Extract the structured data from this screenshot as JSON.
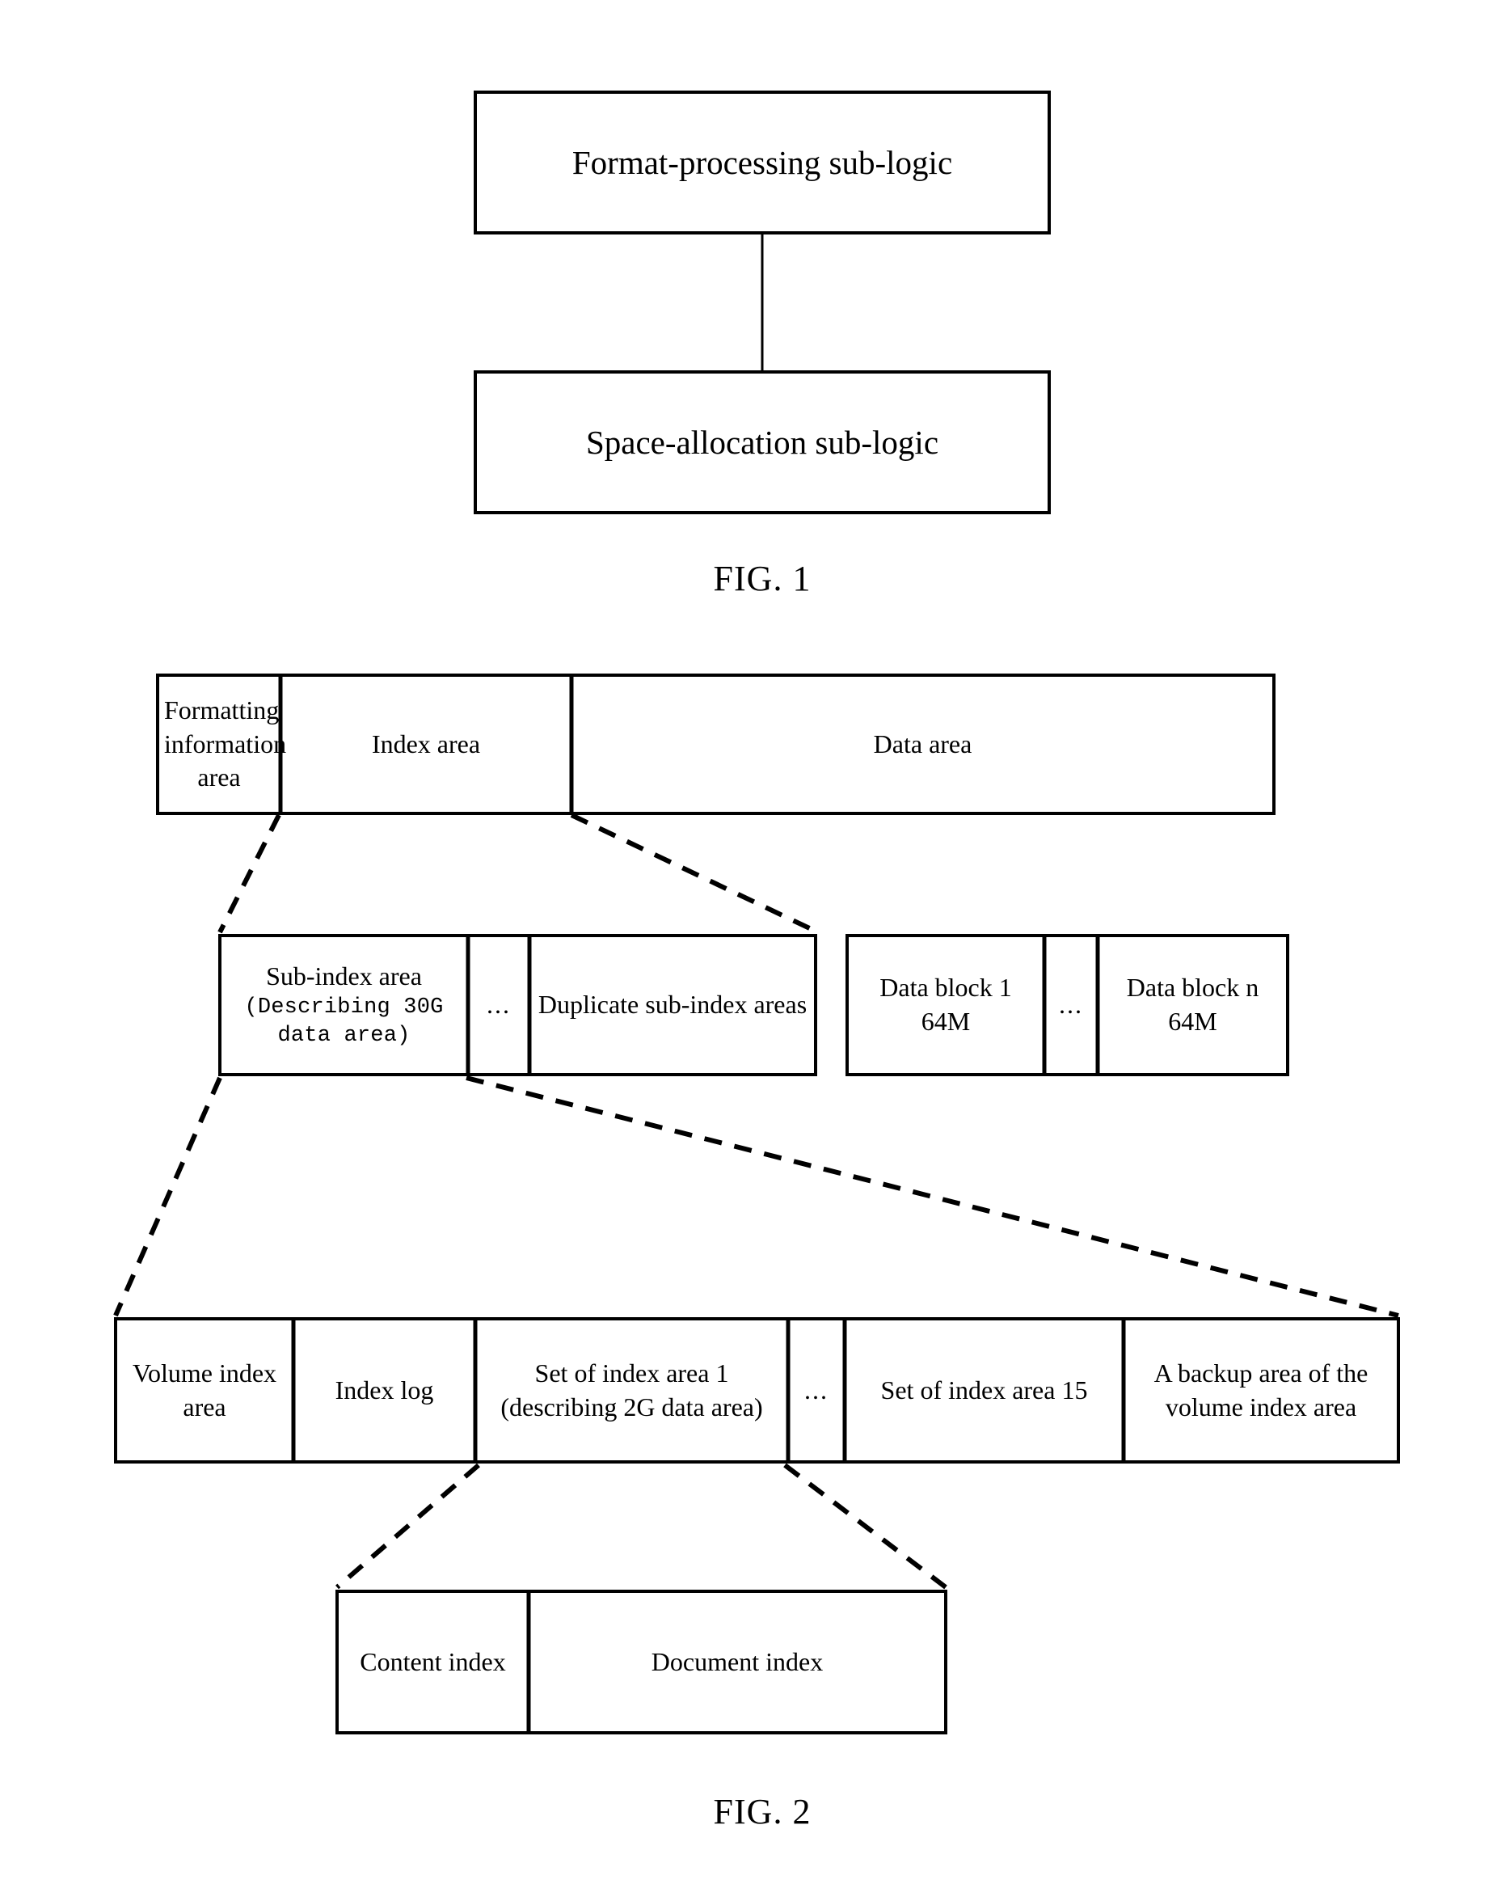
{
  "figures": [
    {
      "id": "fig1",
      "label": "FIG. 1",
      "boxes": [
        {
          "name": "format-processing-sub-logic-box",
          "label": "Format-processing sub-logic"
        },
        {
          "name": "space-allocation-sub-logic-box",
          "label": "Space-allocation sub-logic"
        }
      ],
      "connector": "solid-vertical-line"
    },
    {
      "id": "fig2",
      "label": "FIG. 2",
      "row_disk_layout": {
        "name": "disk-layout-row",
        "cells": [
          {
            "label": "Formatting information area"
          },
          {
            "label": "Index area"
          },
          {
            "label": "Data area"
          }
        ]
      },
      "row_index_area": {
        "name": "index-area-detail-row",
        "cells": [
          {
            "label": "Sub-index area",
            "sublabel": "(Describing 30G data area)"
          },
          {
            "label": "..."
          },
          {
            "label": "Duplicate sub-index areas"
          }
        ]
      },
      "row_data_area": {
        "name": "data-area-detail-row",
        "cells": [
          {
            "label": "Data block 1 64M"
          },
          {
            "label": "..."
          },
          {
            "label": "Data block n 64M"
          }
        ]
      },
      "row_sub_index": {
        "name": "sub-index-area-detail-row",
        "cells": [
          {
            "label": "Volume index area"
          },
          {
            "label": "Index log"
          },
          {
            "label": "Set of index area 1 (describing 2G data area)"
          },
          {
            "label": "..."
          },
          {
            "label": "Set of index area 15"
          },
          {
            "label": "A backup area of the volume index area"
          }
        ]
      },
      "row_index_set": {
        "name": "index-set-detail-row",
        "cells": [
          {
            "label": "Content index"
          },
          {
            "label": "Document index"
          }
        ]
      },
      "connectors": "dashed-expansion-lines"
    }
  ],
  "style": {
    "line_color": "#000000",
    "background": "#ffffff"
  }
}
